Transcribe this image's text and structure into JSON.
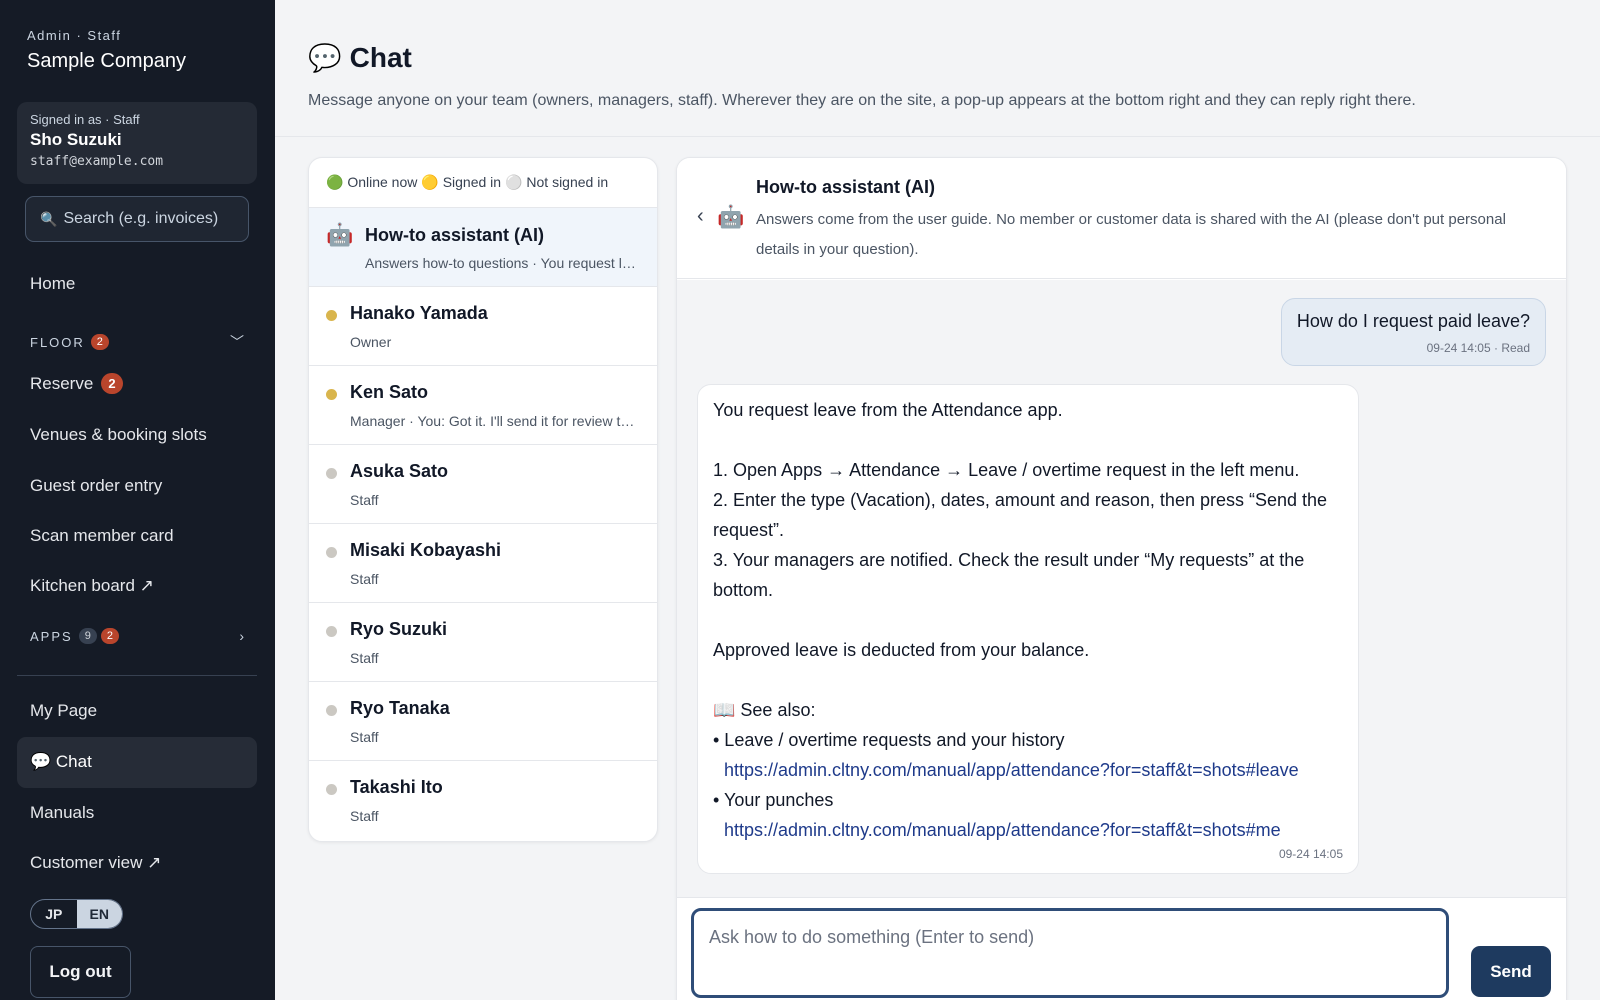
{
  "sidebar": {
    "role_label": "Admin · Staff",
    "company": "Sample Company",
    "user": {
      "signed_in": "Signed in as · Staff",
      "name": "Sho Suzuki",
      "email": "staff@example.com"
    },
    "search": {
      "icon": "search-icon",
      "placeholder": "Search (e.g. invoices)"
    },
    "home": "Home",
    "floor": {
      "label": "FLOOR",
      "badge": "2"
    },
    "reserve": {
      "label": "Reserve",
      "badge": "2"
    },
    "venues": "Venues & booking slots",
    "guest_order": "Guest order entry",
    "scan_card": "Scan member card",
    "kitchen": "Kitchen board ↗",
    "apps": {
      "label": "APPS",
      "count": "9",
      "badge": "2"
    },
    "my_page": "My Page",
    "chat": "💬 Chat",
    "manuals": "Manuals",
    "customer_view": "Customer view ↗",
    "lang": {
      "jp": "JP",
      "en": "EN",
      "active": "EN"
    },
    "logout": "Log out"
  },
  "header": {
    "icon": "💬",
    "title": "Chat",
    "description": "Message anyone on your team (owners, managers, staff). Wherever they are on the site, a pop-up appears at the bottom right and they can reply right there."
  },
  "contacts": {
    "legend": {
      "online": "🟢 Online now",
      "signed_in": "🟡 Signed in",
      "not_signed_in": "⚪ Not signed in"
    },
    "ai": {
      "icon": "🤖",
      "name": "How-to assistant (AI)",
      "sub": "Answers how-to questions · You request leave from the Attendance app."
    },
    "people": [
      {
        "name": "Hanako Yamada",
        "sub": "Owner",
        "status": "signed-in"
      },
      {
        "name": "Ken Sato",
        "sub": "Manager · You: Got it. I'll send it for review today.",
        "status": "signed-in"
      },
      {
        "name": "Asuka Sato",
        "sub": "Staff",
        "status": "not-signed-in"
      },
      {
        "name": "Misaki Kobayashi",
        "sub": "Staff",
        "status": "not-signed-in"
      },
      {
        "name": "Ryo Suzuki",
        "sub": "Staff",
        "status": "not-signed-in"
      },
      {
        "name": "Ryo Tanaka",
        "sub": "Staff",
        "status": "not-signed-in"
      },
      {
        "name": "Takashi Ito",
        "sub": "Staff",
        "status": "not-signed-in"
      }
    ]
  },
  "chat": {
    "back_icon": "‹",
    "robot_icon": "🤖",
    "title": "How-to assistant (AI)",
    "description": "Answers come from the user guide. No member or customer data is shared with the AI (please don't put personal details in your question).",
    "outgoing": {
      "text": "How do I request paid leave?",
      "meta": "09-24 14:05 · Read"
    },
    "incoming": {
      "lines": [
        "You request leave from the Attendance app.",
        "",
        "1. Open Apps → Attendance → Leave / overtime request in the left menu.",
        "2. Enter the type (Vacation), dates, amount and reason, then press “Send the request”.",
        "3. Your managers are notified. Check the result under “My requests” at the bottom.",
        "",
        "Approved leave is deducted from your balance.",
        "",
        "📖 See also:",
        "• Leave / overtime requests and your history"
      ],
      "link1": "https://admin.cltny.com/manual/app/attendance?for=staff&t=shots#leave",
      "line_punches": "• Your punches",
      "link2": "https://admin.cltny.com/manual/app/attendance?for=staff&t=shots#me",
      "meta": "09-24 14:05"
    },
    "composer": {
      "placeholder": "Ask how to do something (Enter to send)",
      "send": "Send"
    }
  },
  "colors": {
    "sidebar_bg": "#151b26",
    "accent": "#1e3a5f",
    "badge_red": "#b9452c",
    "signed_in_dot": "#d9b54d",
    "offline_dot": "#cbc8c2"
  }
}
